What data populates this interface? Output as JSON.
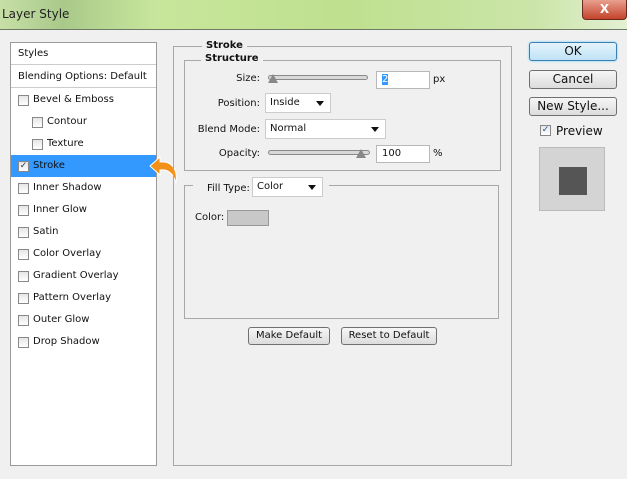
{
  "window": {
    "title": "Layer Style",
    "close_label": "X"
  },
  "sidebar": {
    "header": "Styles",
    "blending": "Blending Options: Default",
    "items": [
      {
        "label": "Bevel & Emboss",
        "checked": false,
        "sub": false
      },
      {
        "label": "Contour",
        "checked": false,
        "sub": true
      },
      {
        "label": "Texture",
        "checked": false,
        "sub": true
      },
      {
        "label": "Stroke",
        "checked": true,
        "sub": false,
        "selected": true
      },
      {
        "label": "Inner Shadow",
        "checked": false,
        "sub": false
      },
      {
        "label": "Inner Glow",
        "checked": false,
        "sub": false
      },
      {
        "label": "Satin",
        "checked": false,
        "sub": false
      },
      {
        "label": "Color Overlay",
        "checked": false,
        "sub": false
      },
      {
        "label": "Gradient Overlay",
        "checked": false,
        "sub": false
      },
      {
        "label": "Pattern Overlay",
        "checked": false,
        "sub": false
      },
      {
        "label": "Outer Glow",
        "checked": false,
        "sub": false
      },
      {
        "label": "Drop Shadow",
        "checked": false,
        "sub": false
      }
    ]
  },
  "stroke": {
    "title": "Stroke",
    "structure": "Structure",
    "size_label": "Size:",
    "size_value": "2",
    "size_unit": "px",
    "size_fraction": 0.0,
    "position_label": "Position:",
    "position_value": "Inside",
    "blend_label": "Blend Mode:",
    "blend_value": "Normal",
    "opacity_label": "Opacity:",
    "opacity_value": "100",
    "opacity_unit": "%",
    "opacity_fraction": 1.0,
    "fill_label": "Fill Type:",
    "fill_value": "Color",
    "color_label": "Color:",
    "color_swatch": "#c8c8c8",
    "make_default": "Make Default",
    "reset_default": "Reset to Default"
  },
  "actions": {
    "ok": "OK",
    "cancel": "Cancel",
    "new_style": "New Style...",
    "preview": "Preview",
    "preview_checked": true
  },
  "colors": {
    "selection": "#3399ff",
    "arrow": "#f39019",
    "preview_square": "#555555"
  }
}
